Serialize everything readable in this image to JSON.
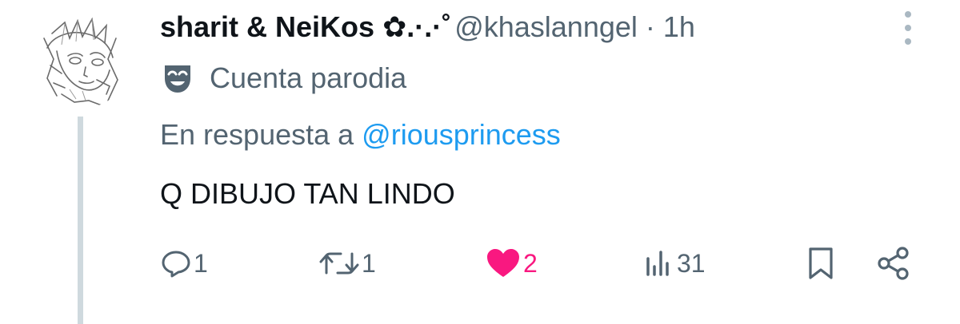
{
  "author": {
    "display_name": "sharit & NeiKos ✿.·.·˚",
    "handle": "@khaslanngel",
    "separator": "·",
    "time": "1h"
  },
  "label": {
    "icon": "parody-mask-icon",
    "text": "Cuenta parodia"
  },
  "reply": {
    "prefix": "En respuesta a",
    "handle": "@riousprincess"
  },
  "tweet": {
    "text": "Q DIBUJO TAN LINDO"
  },
  "actions": {
    "replies": "1",
    "reposts": "1",
    "likes": "2",
    "views": "31"
  },
  "colors": {
    "text": "#0f1419",
    "secondary": "#536471",
    "link": "#1d9bf0",
    "like": "#f91880",
    "thread_line": "#cfd9de"
  }
}
